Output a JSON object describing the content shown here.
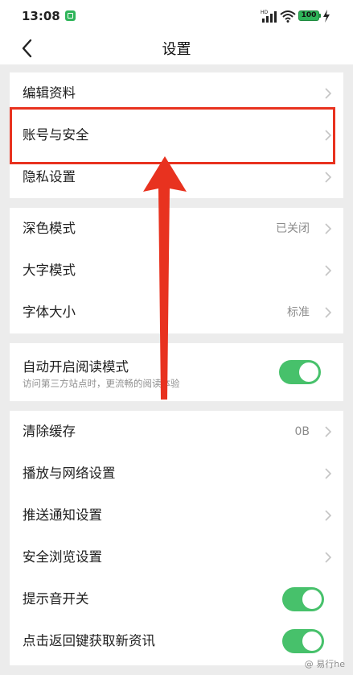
{
  "status_bar": {
    "time": "13:08",
    "battery": "100"
  },
  "nav": {
    "title": "设置"
  },
  "groups": [
    {
      "items": [
        {
          "label": "编辑资料"
        },
        {
          "label": "账号与安全"
        },
        {
          "label": "隐私设置"
        }
      ]
    },
    {
      "items": [
        {
          "label": "深色模式",
          "value": "已关闭"
        },
        {
          "label": "大字模式"
        },
        {
          "label": "字体大小",
          "value": "标准"
        }
      ]
    },
    {
      "items": [
        {
          "label": "自动开启阅读模式",
          "description": "访问第三方站点时，更流畅的阅读体验",
          "toggle_on": true
        }
      ]
    },
    {
      "items": [
        {
          "label": "清除缓存",
          "value": "0B"
        },
        {
          "label": "播放与网络设置"
        },
        {
          "label": "推送通知设置"
        },
        {
          "label": "安全浏览设置"
        },
        {
          "label": "提示音开关",
          "toggle_on": true
        },
        {
          "label": "点击返回键获取新资讯",
          "toggle_on": true
        }
      ]
    }
  ],
  "annotation": {
    "highlight_color": "#e8321f"
  },
  "watermark": "@ 易行he",
  "colors": {
    "toggle_on": "#47c16b",
    "background": "#ececec"
  }
}
